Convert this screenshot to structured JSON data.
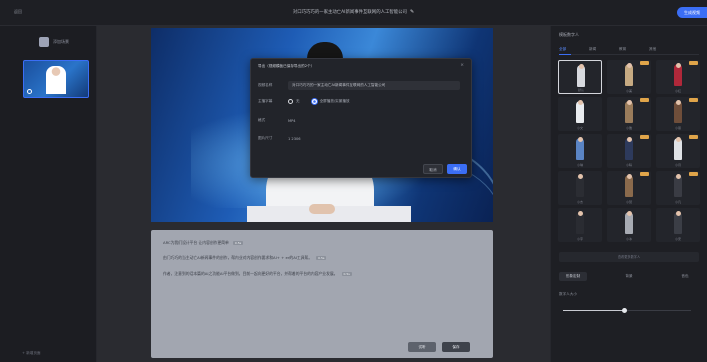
{
  "topbar": {
    "back_label": "返回",
    "project_title": "对口巧巧巧的一家主动亡AI新闻事件互联网的人工智能公司",
    "primary_label": "生成视频"
  },
  "left_panel": {
    "scene_label": "添加场景",
    "bottom_label": "+ 新增页面"
  },
  "modal": {
    "title": "导出（视频模板已保存导出的2个）",
    "fields": {
      "name_label": "视频名称",
      "name_value": "对口巧巧巧的一家主动亡AI新闻事件互联网的人工智能公司",
      "subtitle_label": "主播字幕",
      "radio_off_label": "无",
      "radio_on_label": "全屏播放/实景播放",
      "format_label": "格式",
      "format_value": "MP4",
      "resolution_label": "图片尺寸",
      "resolution_value": "1 2306"
    },
    "cancel_label": "取消",
    "ok_label": "确认"
  },
  "script": {
    "lines": [
      {
        "text": "ARC为我们设计平台 让内容创作更简单",
        "tag": "0.5s"
      },
      {
        "text": "由门巧巧的当主动亡AI新闻事件的创作，帮内业对内容创作要求和AI+ + er的AI工具帮。",
        "tag": "0.5s"
      },
      {
        "text": "作者，注意到的话本篇的AI之功能AI平台做到，目前一起向更好的平台，并帮着的平台的内容产业发展。",
        "tag": "0.5s"
      }
    ],
    "preview_label": "试听",
    "save_label": "保存"
  },
  "right_panel": {
    "title": "模板数字人",
    "tabs": [
      "全部",
      "新闻",
      "教育",
      "其他"
    ],
    "avatars": [
      {
        "caption": "默认",
        "color": "#d8dadf",
        "badge": false,
        "selected": true
      },
      {
        "caption": "小美",
        "color": "#c6aa82",
        "badge": true,
        "selected": false
      },
      {
        "caption": "小红",
        "color": "#b0283a",
        "badge": true,
        "selected": false
      },
      {
        "caption": "小文",
        "color": "#e9ecef",
        "badge": false,
        "selected": false
      },
      {
        "caption": "小雅",
        "color": "#9a7c5b",
        "badge": true,
        "selected": false
      },
      {
        "caption": "小丽",
        "color": "#6f4e3a",
        "badge": true,
        "selected": false
      },
      {
        "caption": "小琳",
        "color": "#5a84c4",
        "badge": false,
        "selected": false
      },
      {
        "caption": "小晴",
        "color": "#2d3a5c",
        "badge": true,
        "selected": false
      },
      {
        "caption": "小月",
        "color": "#dfe2e6",
        "badge": true,
        "selected": false
      },
      {
        "caption": "小杰",
        "color": "#2b2d33",
        "badge": false,
        "selected": false
      },
      {
        "caption": "小慧",
        "color": "#8a6a4c",
        "badge": true,
        "selected": false
      },
      {
        "caption": "小凡",
        "color": "#3a3c44",
        "badge": true,
        "selected": false
      },
      {
        "caption": "小宇",
        "color": "#2a2c32",
        "badge": false,
        "selected": false
      },
      {
        "caption": "小冰",
        "color": "#a7abb3",
        "badge": false,
        "selected": false
      },
      {
        "caption": "小安",
        "color": "#3b3e46",
        "badge": false,
        "selected": false
      }
    ],
    "more_label": "查看更多数字人",
    "sub_tabs": [
      "形象定制",
      "背景",
      "音色"
    ],
    "slider_label": "数字人大小",
    "slider_value": 0.48
  }
}
